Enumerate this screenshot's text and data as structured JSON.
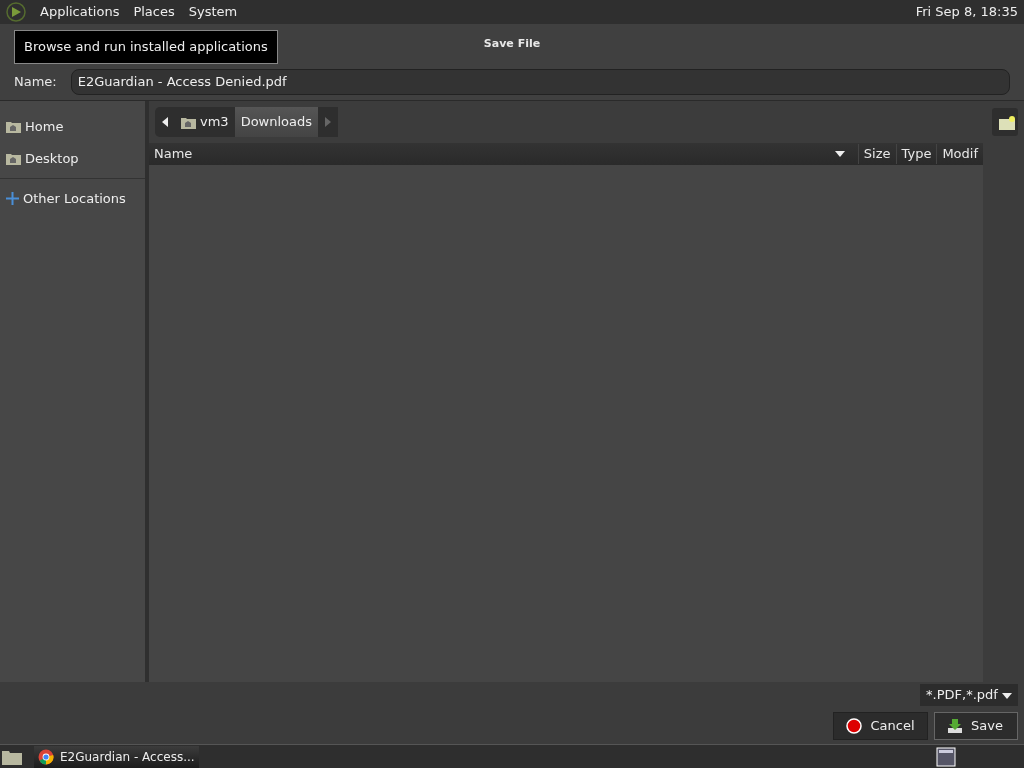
{
  "top_panel": {
    "menus": [
      "Applications",
      "Places",
      "System"
    ],
    "clock": "Fri Sep  8, 18:35"
  },
  "tooltip": "Browse and run installed applications",
  "dialog": {
    "title": "Save File",
    "name_label": "Name:",
    "name_value": "E2Guardian - Access Denied.pdf",
    "sidebar": [
      {
        "label": "Home",
        "kind": "folder"
      },
      {
        "label": "Desktop",
        "kind": "folder"
      },
      {
        "label": "Other Locations",
        "kind": "plus"
      }
    ],
    "path": [
      {
        "label": "vm3",
        "selected": false
      },
      {
        "label": "Downloads",
        "selected": true
      }
    ],
    "columns": [
      "Name",
      "Size",
      "Type",
      "Modif"
    ],
    "filter": "*.PDF,*.pdf",
    "buttons": [
      {
        "label": "Cancel",
        "kind": "cancel"
      },
      {
        "label": "Save",
        "kind": "save"
      }
    ]
  },
  "taskbar": {
    "windows": [
      {
        "label": "E2Guardian - Access...",
        "selected": true
      }
    ]
  }
}
